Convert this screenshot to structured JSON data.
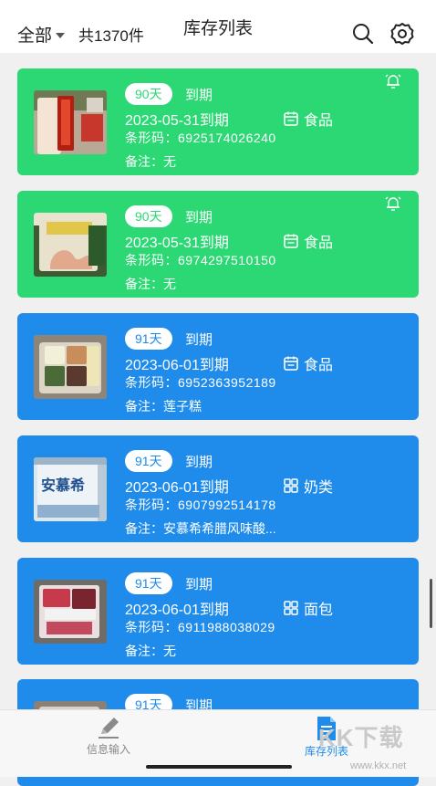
{
  "header": {
    "filter_label": "全部",
    "count_label": "共1370件",
    "title": "库存列表"
  },
  "icons": {
    "search": "search-icon",
    "settings": "settings-icon",
    "bell": "bell-icon",
    "food_category": "calendar-icon",
    "grid_category": "grid-icon",
    "tab_input": "pencil-icon",
    "tab_list": "document-icon"
  },
  "colors": {
    "green_card": "#2bd874",
    "blue_card": "#1f8cec",
    "active_tab": "#1f8cec"
  },
  "items": [
    {
      "days": "90天",
      "expire_label": "到期",
      "date": "2023-05-31到期",
      "category": "食品",
      "barcode": "条形码：6925174026240",
      "note": "备注：无",
      "status": "green",
      "has_bell": true
    },
    {
      "days": "90天",
      "expire_label": "到期",
      "date": "2023-05-31到期",
      "category": "食品",
      "barcode": "条形码：6974297510150",
      "note": "备注：无",
      "status": "green",
      "has_bell": true
    },
    {
      "days": "91天",
      "expire_label": "到期",
      "date": "2023-06-01到期",
      "category": "食品",
      "barcode": "条形码：6952363952189",
      "note": "备注：莲子糕",
      "status": "blue",
      "has_bell": false
    },
    {
      "days": "91天",
      "expire_label": "到期",
      "date": "2023-06-01到期",
      "category": "奶类",
      "barcode": "条形码：6907992514178",
      "note": "备注：安慕希希腊风味酸...",
      "status": "blue",
      "has_bell": false,
      "thumb_text": "安慕希"
    },
    {
      "days": "91天",
      "expire_label": "到期",
      "date": "2023-06-01到期",
      "category": "面包",
      "barcode": "条形码：6911988038029",
      "note": "备注：无",
      "status": "blue",
      "has_bell": false
    },
    {
      "days": "91天",
      "expire_label": "到期",
      "status": "blue"
    }
  ],
  "bottom_nav": {
    "tab_input_label": "信息输入",
    "tab_list_label": "库存列表"
  },
  "watermark": {
    "text": "KK下载",
    "url": "www.kkx.net"
  }
}
